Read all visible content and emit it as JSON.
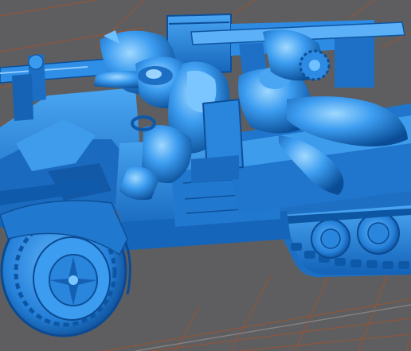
{
  "scene": {
    "colors": {
      "background": "#5e5e60",
      "grid": "#a0522d",
      "model": "#2b8de6",
      "model_dark": "#0b4f98",
      "model_light": "#8fd0ff"
    }
  }
}
